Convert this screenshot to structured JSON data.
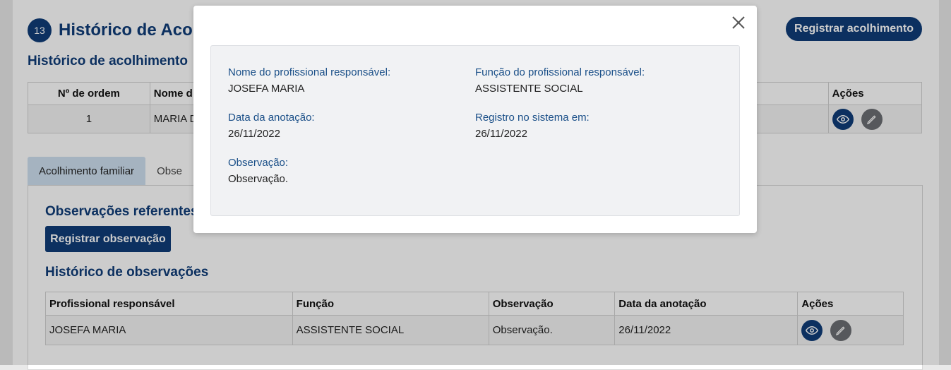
{
  "header": {
    "step_number": "13",
    "title": "Histórico de Acol",
    "register_button": "Registrar acolhimento"
  },
  "history_section": {
    "title": "Histórico de acolhimento",
    "columns": [
      "Nº de ordem",
      "Nome d",
      "Ações"
    ],
    "rows": [
      {
        "order": "1",
        "name": "MARIA D"
      }
    ]
  },
  "tabs": [
    {
      "label": "Acolhimento familiar",
      "active": true
    },
    {
      "label": "Obse",
      "active": false
    }
  ],
  "observations": {
    "title": "Observações referentes",
    "register_button": "Registrar observação",
    "history_title": "Histórico de observações",
    "columns": [
      "Profissional responsável",
      "Função",
      "Observação",
      "Data da anotação",
      "Ações"
    ],
    "rows": [
      {
        "professional": "JOSEFA MARIA",
        "role": "ASSISTENTE SOCIAL",
        "observation": "Observação.",
        "date": "26/11/2022"
      }
    ]
  },
  "modal": {
    "professional_label": "Nome do profissional responsável:",
    "professional_value": "JOSEFA MARIA",
    "role_label": "Função do profissional responsável:",
    "role_value": "ASSISTENTE SOCIAL",
    "date_label": "Data da anotação:",
    "date_value": "26/11/2022",
    "system_label": "Registro no sistema em:",
    "system_value": "26/11/2022",
    "observation_label": "Observação:",
    "observation_value": "Observação."
  },
  "colors": {
    "primary": "#0f3d78",
    "label_blue": "#1a4f88",
    "edit_gray": "#6c6f73",
    "tab_active": "#cfe0f1"
  },
  "icons": [
    "eye-icon",
    "pencil-icon",
    "close-icon"
  ]
}
